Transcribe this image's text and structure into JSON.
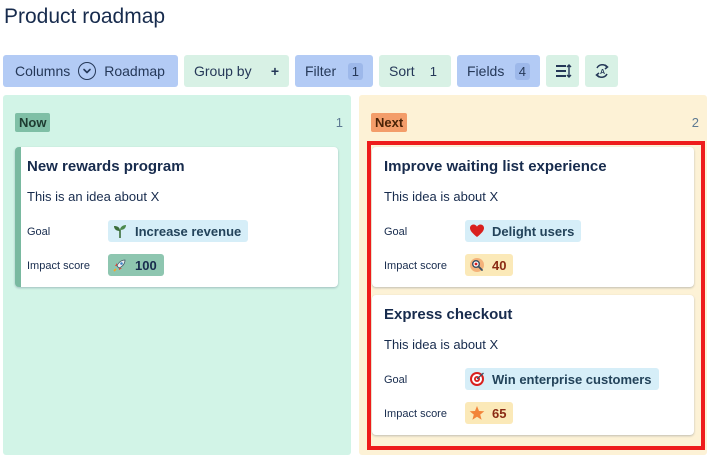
{
  "page": {
    "title": "Product roadmap"
  },
  "toolbar": {
    "columns_label": "Columns",
    "columns_value": "Roadmap",
    "group_by_label": "Group by",
    "group_by_plus": "+",
    "filter_label": "Filter",
    "filter_count": "1",
    "sort_label": "Sort",
    "sort_count": "1",
    "fields_label": "Fields",
    "fields_count": "4"
  },
  "columns": [
    {
      "label": "Now",
      "count": "1",
      "color": "#d2f4e7",
      "cards": [
        {
          "title": "New rewards program",
          "description": "This is an idea about X",
          "goal_label": "Goal",
          "goal": "Increase revenue",
          "goal_icon": "sprout-icon",
          "score_label": "Impact score",
          "score": "100",
          "score_icon": "rocket-icon"
        }
      ]
    },
    {
      "label": "Next",
      "count": "2",
      "color": "#fdf2d6",
      "cards": [
        {
          "title": "Improve waiting list experience",
          "description": "This idea is about X",
          "goal_label": "Goal",
          "goal": "Delight users",
          "goal_icon": "heart-icon",
          "score_label": "Impact score",
          "score": "40",
          "score_icon": "magnifier-icon"
        },
        {
          "title": "Express checkout",
          "description": "This idea is about X",
          "goal_label": "Goal",
          "goal": "Win enterprise customers",
          "goal_icon": "target-icon",
          "score_label": "Impact score",
          "score": "65",
          "score_icon": "star-icon"
        }
      ]
    }
  ],
  "colors": {
    "highlight": "#ee1c1c",
    "accent_blue": "#b3cbf5",
    "accent_green": "#d8f1e5"
  }
}
